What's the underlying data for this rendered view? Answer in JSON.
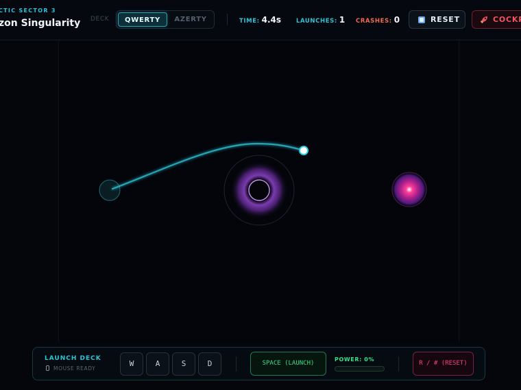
{
  "header": {
    "sector": "CTIC SECTOR 3",
    "level_title": "zon Singularity",
    "deck_label": "DECK",
    "layouts": [
      "QWERTY",
      "AZERTY"
    ],
    "active_layout": "QWERTY",
    "stats": {
      "time_label": "TIME:",
      "time_value": "4.4s",
      "launches_label": "LAUNCHES:",
      "launches_value": "1",
      "crashes_label": "CRASHES:",
      "crashes_value": "0"
    },
    "reset_label": "RESET",
    "cockpit_label": "COCKPIT"
  },
  "icons": {
    "reset": "reset-square-icon",
    "cockpit": "rocket-icon",
    "mouse": "mouse-icon"
  },
  "deck": {
    "title": "LAUNCH DECK",
    "mouse_status": "MOUSE READY",
    "keys": [
      "W",
      "A",
      "S",
      "D"
    ],
    "launch_label": "SPACE (LAUNCH)",
    "power_label": "POWER: 0%",
    "power_level": 0,
    "reset_label": "R / # (RESET)"
  },
  "colors": {
    "cyan": "#2ec4d6",
    "green": "#38e08a",
    "red": "#ef6a4f",
    "pink": "#ff3f86",
    "violet": "#8a3fbf",
    "target": "#ff2d8a"
  }
}
